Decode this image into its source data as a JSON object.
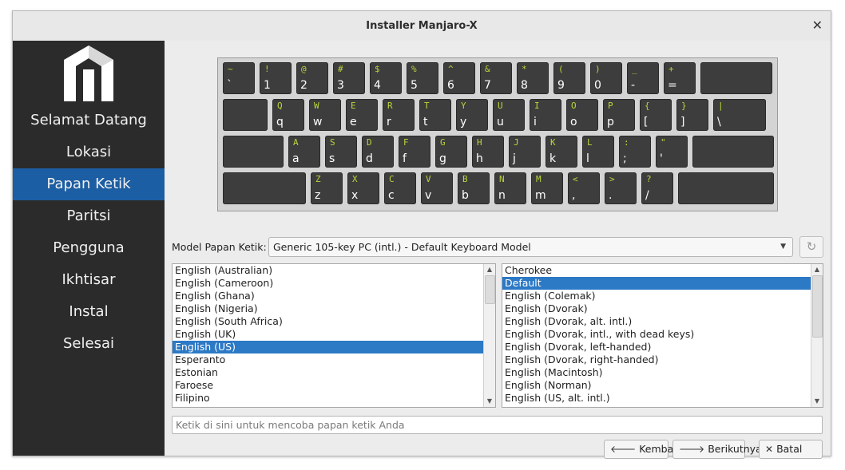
{
  "window": {
    "title": "Installer Manjaro-X",
    "close_glyph": "✕"
  },
  "sidebar": {
    "items": [
      {
        "label": "Selamat Datang"
      },
      {
        "label": "Lokasi"
      },
      {
        "label": "Papan Ketik",
        "active": true
      },
      {
        "label": "Paritsi"
      },
      {
        "label": "Pengguna"
      },
      {
        "label": "Ikhtisar"
      },
      {
        "label": "Instal"
      },
      {
        "label": "Selesai"
      }
    ]
  },
  "keyboard": {
    "rows": [
      [
        [
          "~",
          "`"
        ],
        [
          "!",
          "1"
        ],
        [
          "@",
          "2"
        ],
        [
          "#",
          "3"
        ],
        [
          "$",
          "4"
        ],
        [
          "%",
          "5"
        ],
        [
          "^",
          "6"
        ],
        [
          "&",
          "7"
        ],
        [
          "*",
          "8"
        ],
        [
          "(",
          "9"
        ],
        [
          ")",
          "0"
        ],
        [
          "_",
          "-"
        ],
        [
          "+",
          "="
        ],
        [
          "",
          ""
        ]
      ],
      [
        [
          "",
          ""
        ],
        [
          "Q",
          "q"
        ],
        [
          "W",
          "w"
        ],
        [
          "E",
          "e"
        ],
        [
          "R",
          "r"
        ],
        [
          "T",
          "t"
        ],
        [
          "Y",
          "y"
        ],
        [
          "U",
          "u"
        ],
        [
          "I",
          "i"
        ],
        [
          "O",
          "o"
        ],
        [
          "P",
          "p"
        ],
        [
          "{",
          "["
        ],
        [
          "}",
          "]"
        ],
        [
          "|",
          "\\"
        ]
      ],
      [
        [
          "",
          ""
        ],
        [
          "A",
          "a"
        ],
        [
          "S",
          "s"
        ],
        [
          "D",
          "d"
        ],
        [
          "F",
          "f"
        ],
        [
          "G",
          "g"
        ],
        [
          "H",
          "h"
        ],
        [
          "J",
          "j"
        ],
        [
          "K",
          "k"
        ],
        [
          "L",
          "l"
        ],
        [
          ":",
          ";"
        ],
        [
          "\"",
          "'"
        ],
        [
          "",
          ""
        ]
      ],
      [
        [
          "",
          ""
        ],
        [
          "Z",
          "z"
        ],
        [
          "X",
          "x"
        ],
        [
          "C",
          "c"
        ],
        [
          "V",
          "v"
        ],
        [
          "B",
          "b"
        ],
        [
          "N",
          "n"
        ],
        [
          "M",
          "m"
        ],
        [
          "<",
          ","
        ],
        [
          ">",
          "."
        ],
        [
          "?",
          "/"
        ],
        [
          "",
          ""
        ]
      ]
    ]
  },
  "model": {
    "label": "Model Papan Ketik:",
    "value": "Generic 105-key PC (intl.)  -  Default Keyboard Model",
    "reset_icon": "reset-icon"
  },
  "layouts": {
    "items": [
      "English (Australian)",
      "English (Cameroon)",
      "English (Ghana)",
      "English (Nigeria)",
      "English (South Africa)",
      "English (UK)",
      "English (US)",
      "Esperanto",
      "Estonian",
      "Faroese",
      "Filipino"
    ],
    "selected": "English (US)"
  },
  "variants": {
    "items": [
      "Cherokee",
      "Default",
      "English (Colemak)",
      "English (Dvorak)",
      "English (Dvorak, alt. intl.)",
      "English (Dvorak, intl., with dead keys)",
      "English (Dvorak, left-handed)",
      "English (Dvorak, right-handed)",
      "English (Macintosh)",
      "English (Norman)",
      "English (US, alt. intl.)"
    ],
    "selected": "Default"
  },
  "test_input": {
    "placeholder": "Ketik di sini untuk mencoba papan ketik Anda",
    "value": ""
  },
  "buttons": {
    "back": {
      "label": "Kembali",
      "icon": "arrow-left-icon"
    },
    "next": {
      "label": "Berikutnya",
      "icon": "arrow-right-icon"
    },
    "cancel": {
      "label": "Batal",
      "icon": "close-icon"
    }
  }
}
